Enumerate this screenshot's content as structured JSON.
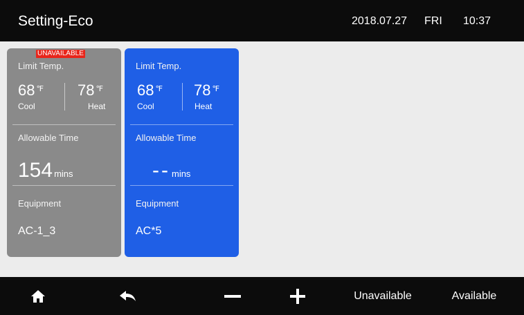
{
  "header": {
    "title": "Setting-Eco",
    "date": "2018.07.27",
    "weekday": "FRI",
    "time": "10:37"
  },
  "cards": [
    {
      "badge": "UNAVAILABLE",
      "limit_label": "Limit Temp.",
      "cool_value": "68",
      "heat_value": "78",
      "unit": "℉",
      "cool_label": "Cool",
      "heat_label": "Heat",
      "allow_label": "Allowable Time",
      "time_value": "154",
      "time_unit": "mins",
      "equip_label": "Equipment",
      "equip_value": "AC-1_3",
      "color": "#8a8a8a"
    },
    {
      "limit_label": "Limit Temp.",
      "cool_value": "68",
      "heat_value": "78",
      "unit": "℉",
      "cool_label": "Cool",
      "heat_label": "Heat",
      "allow_label": "Allowable Time",
      "time_value": "--",
      "time_unit": "mins",
      "equip_label": "Equipment",
      "equip_value": "AC*5",
      "color": "#1f5fe6"
    }
  ],
  "footer": {
    "home_icon": "home-icon",
    "back_icon": "back-arrow-icon",
    "minus_icon": "minus-icon",
    "plus_icon": "plus-icon",
    "unavailable_label": "Unavailable",
    "available_label": "Available"
  }
}
